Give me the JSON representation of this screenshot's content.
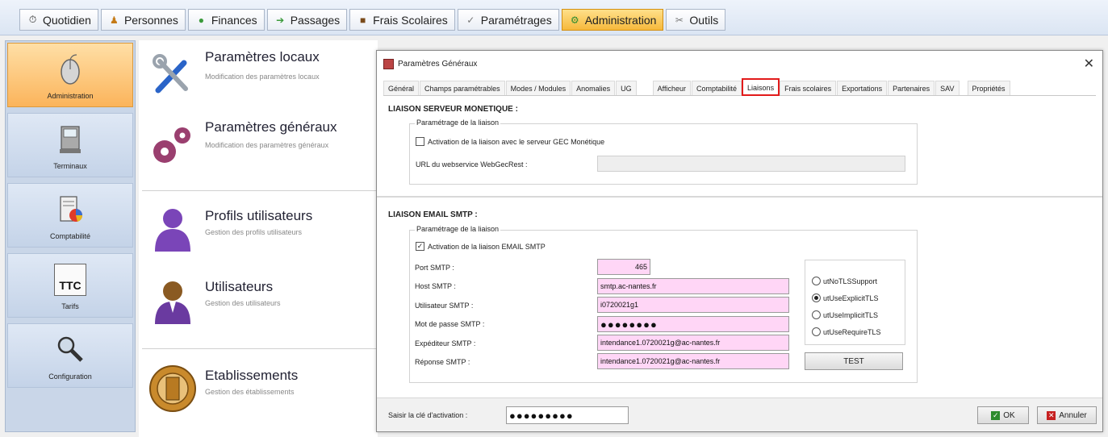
{
  "menu": [
    {
      "label": "Quotidien",
      "icon": "clock-icon"
    },
    {
      "label": "Personnes",
      "icon": "person-icon"
    },
    {
      "label": "Finances",
      "icon": "coins-icon"
    },
    {
      "label": "Passages",
      "icon": "arrow-icon"
    },
    {
      "label": "Frais Scolaires",
      "icon": "chest-icon"
    },
    {
      "label": "Paramétrages",
      "icon": "check-icon"
    },
    {
      "label": "Administration",
      "icon": "gear-icon"
    },
    {
      "label": "Outils",
      "icon": "tools-icon"
    }
  ],
  "sidebar": [
    {
      "label": "Administration"
    },
    {
      "label": "Terminaux"
    },
    {
      "label": "Comptabilité"
    },
    {
      "label": "Tarifs",
      "icon_text": "TTC"
    },
    {
      "label": "Configuration"
    }
  ],
  "entries": [
    {
      "title": "Paramètres locaux",
      "subtitle": "Modification des paramètres locaux"
    },
    {
      "title": "Paramètres généraux",
      "subtitle": "Modification des paramètres généraux"
    },
    {
      "title": "Profils utilisateurs",
      "subtitle": "Gestion des profils utilisateurs"
    },
    {
      "title": "Utilisateurs",
      "subtitle": "Gestion des utilisateurs"
    },
    {
      "title": "Etablissements",
      "subtitle": "Gestion des établissements"
    }
  ],
  "dialog": {
    "title": "Paramètres Généraux",
    "close": "✕",
    "tabs": [
      "Général",
      "Champs paramétrables",
      "Modes / Modules",
      "Anomalies",
      "UG",
      "Afficheur",
      "Comptabilité",
      "Liaisons",
      "Frais scolaires",
      "Exportations",
      "Partenaires",
      "SAV",
      "Propriétés"
    ],
    "active_tab": "Liaisons",
    "monetique": {
      "section_title": "LIAISON SERVEUR MONETIQUE :",
      "group_title": "Paramétrage de la liaison",
      "activation_label": "Activation de la liaison avec le serveur GEC Monétique",
      "activation_checked": false,
      "url_label": "URL du webservice WebGecRest :",
      "url_value": ""
    },
    "smtp": {
      "section_title": "LIAISON EMAIL SMTP :",
      "group_title": "Paramétrage de la liaison",
      "activation_label": "Activation de la liaison EMAIL SMTP",
      "activation_checked": true,
      "port_label": "Port SMTP :",
      "port_value": "465",
      "host_label": "Host SMTP :",
      "host_value": "smtp.ac-nantes.fr",
      "user_label": "Utilisateur SMTP :",
      "user_value": "i0720021g1",
      "password_label": "Mot de passe SMTP :",
      "password_value": "●●●●●●●●",
      "sender_label": "Expéditeur SMTP :",
      "sender_value": "intendance1.0720021g@ac-nantes.fr",
      "reply_label": "Réponse SMTP :",
      "reply_value": "intendance1.0720021g@ac-nantes.fr",
      "tls_options": [
        "utNoTLSSupport",
        "utUseExplicitTLS",
        "utUseImplicitTLS",
        "utUseRequireTLS"
      ],
      "tls_selected": "utUseExplicitTLS",
      "test_label": "TEST"
    },
    "footer": {
      "activation_key_label": "Saisir la clé d'activation :",
      "activation_key_value": "●●●●●●●●●",
      "ok_label": "OK",
      "cancel_label": "Annuler"
    }
  }
}
